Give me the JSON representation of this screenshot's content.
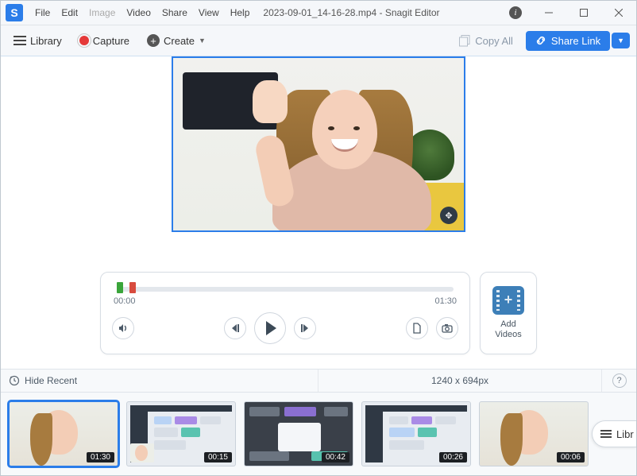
{
  "titlebar": {
    "menus": [
      "File",
      "Edit",
      "Image",
      "Video",
      "Share",
      "View",
      "Help"
    ],
    "title": "2023-09-01_14-16-28.mp4 - Snagit Editor"
  },
  "toolbar": {
    "library_label": "Library",
    "capture_label": "Capture",
    "create_label": "Create",
    "copy_all_label": "Copy All",
    "share_label": "Share Link"
  },
  "player": {
    "time_start": "00:00",
    "time_end": "01:30",
    "add_videos_label_1": "Add",
    "add_videos_label_2": "Videos"
  },
  "status": {
    "hide_recent_label": "Hide Recent",
    "dimensions": "1240 x 694px"
  },
  "thumbs": [
    {
      "duration": "01:30",
      "selected": true,
      "kind": "person"
    },
    {
      "duration": "00:15",
      "selected": false,
      "kind": "app-light"
    },
    {
      "duration": "00:42",
      "selected": false,
      "kind": "app-dark"
    },
    {
      "duration": "00:26",
      "selected": false,
      "kind": "app-light2"
    },
    {
      "duration": "00:06",
      "selected": false,
      "kind": "person"
    }
  ],
  "library_pill": "Libr"
}
